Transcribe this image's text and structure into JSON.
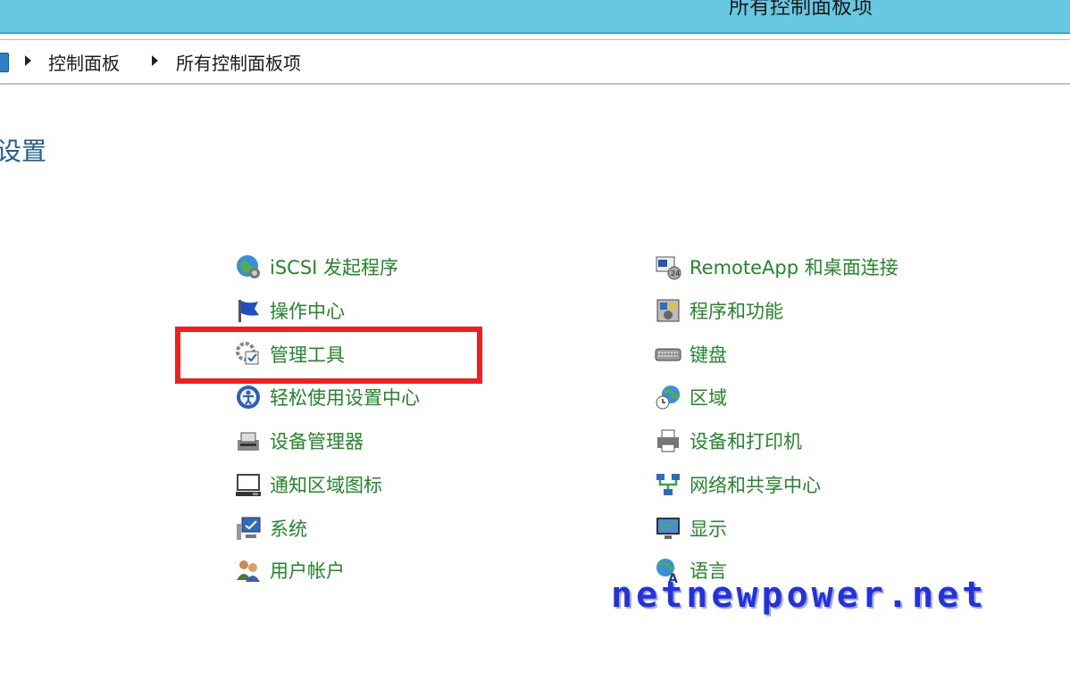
{
  "window": {
    "title": "所有控制面板项"
  },
  "breadcrumb": {
    "items": [
      "控制面板",
      "所有控制面板项"
    ]
  },
  "section": {
    "heading": "设置"
  },
  "left_column": [
    {
      "label": "iSCSI 发起程序",
      "icon": "iscsi-globe-icon"
    },
    {
      "label": "操作中心",
      "icon": "action-center-flag-icon"
    },
    {
      "label": "管理工具",
      "icon": "admin-tools-icon"
    },
    {
      "label": "轻松使用设置中心",
      "icon": "ease-of-access-icon"
    },
    {
      "label": "设备管理器",
      "icon": "device-manager-icon"
    },
    {
      "label": "通知区域图标",
      "icon": "notification-area-icon"
    },
    {
      "label": "系统",
      "icon": "system-icon"
    },
    {
      "label": "用户帐户",
      "icon": "user-accounts-icon"
    }
  ],
  "right_column": [
    {
      "label": "RemoteApp 和桌面连接",
      "icon": "remoteapp-icon"
    },
    {
      "label": "程序和功能",
      "icon": "programs-features-icon"
    },
    {
      "label": "键盘",
      "icon": "keyboard-icon"
    },
    {
      "label": "区域",
      "icon": "region-clock-icon"
    },
    {
      "label": "设备和打印机",
      "icon": "printer-icon"
    },
    {
      "label": "网络和共享中心",
      "icon": "network-icon"
    },
    {
      "label": "显示",
      "icon": "display-icon"
    },
    {
      "label": "语言",
      "icon": "language-icon"
    }
  ],
  "watermark": {
    "text": "netnewpower.net"
  },
  "colors": {
    "link": "#1f8a26",
    "heading": "#1e5aa0",
    "titlebar": "#68c8e2",
    "highlight": "#ee2020"
  }
}
